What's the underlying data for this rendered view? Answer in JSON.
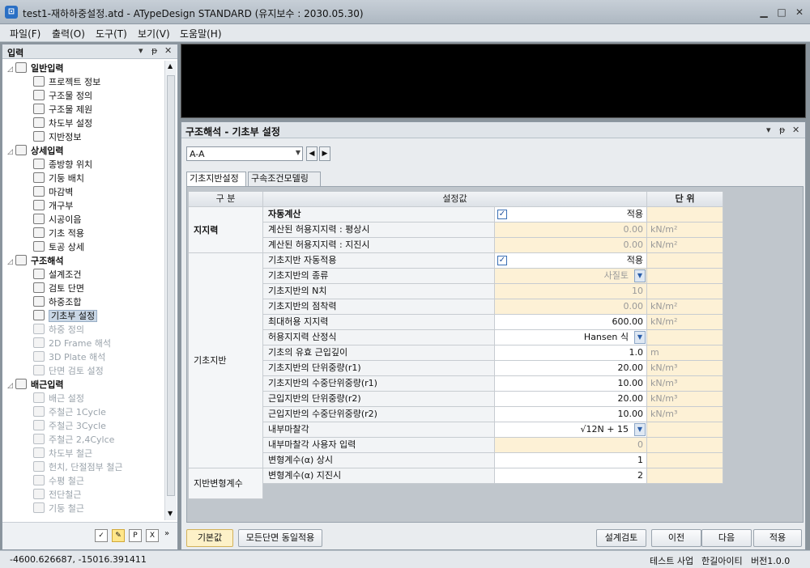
{
  "window": {
    "title": "test1-재하하중설정.atd - ATypeDesign STANDARD  (유지보수 : 2030.05.30)"
  },
  "menu": [
    "파일(F)",
    "출력(O)",
    "도구(T)",
    "보기(V)",
    "도움말(H)"
  ],
  "left_panel": {
    "title": "입력",
    "tree": [
      {
        "label": "일반입력",
        "group": true,
        "icon": "document-icon"
      },
      {
        "label": "프로젝트 정보",
        "icon": "project-info-icon"
      },
      {
        "label": "구조물 정의",
        "icon": "structure-define-icon"
      },
      {
        "label": "구조물 제원",
        "icon": "structure-spec-icon"
      },
      {
        "label": "차도부 설정",
        "icon": "road-setting-icon"
      },
      {
        "label": "지반정보",
        "icon": "ground-info-icon"
      },
      {
        "label": "상세입력",
        "group": true,
        "icon": "detail-input-icon"
      },
      {
        "label": "종방향 위치",
        "icon": "longitudinal-position-icon"
      },
      {
        "label": "기둥 배치",
        "icon": "column-layout-icon"
      },
      {
        "label": "마감벽",
        "icon": "finish-wall-icon"
      },
      {
        "label": "개구부",
        "icon": "opening-icon"
      },
      {
        "label": "시공이음",
        "icon": "construction-joint-icon"
      },
      {
        "label": "기초 적용",
        "icon": "foundation-apply-icon"
      },
      {
        "label": "토공 상세",
        "icon": "earthwork-icon"
      },
      {
        "label": "구조해석",
        "group": true,
        "icon": "structural-analysis-icon"
      },
      {
        "label": "설계조건",
        "icon": "design-condition-icon"
      },
      {
        "label": "검토 단면",
        "icon": "review-section-icon"
      },
      {
        "label": "하중조합",
        "icon": "load-combination-icon"
      },
      {
        "label": "기초부 설정",
        "icon": "foundation-setting-icon",
        "selected": true
      },
      {
        "label": "하중 정의",
        "icon": "load-define-icon",
        "disabled": true
      },
      {
        "label": "2D Frame 해석",
        "icon": "frame-2d-icon",
        "disabled": true
      },
      {
        "label": "3D Plate 해석",
        "icon": "plate-3d-icon",
        "disabled": true
      },
      {
        "label": "단면 검토 설정",
        "icon": "section-check-icon",
        "disabled": true
      },
      {
        "label": "배근입력",
        "group": true,
        "icon": "rebar-input-icon"
      },
      {
        "label": "배근 설정",
        "icon": "rebar-setting-icon",
        "disabled": true
      },
      {
        "label": "주철근 1Cycle",
        "icon": "main-rebar-1-icon",
        "disabled": true
      },
      {
        "label": "주철근 3Cycle",
        "icon": "main-rebar-3-icon",
        "disabled": true
      },
      {
        "label": "주철근 2,4Cylce",
        "icon": "main-rebar-24-icon",
        "disabled": true
      },
      {
        "label": "차도부 철근",
        "icon": "road-rebar-icon",
        "disabled": true
      },
      {
        "label": "헌치, 단절점부 철근",
        "icon": "haunch-rebar-icon",
        "disabled": true
      },
      {
        "label": "수평 철근",
        "icon": "horizontal-rebar-icon",
        "disabled": true
      },
      {
        "label": "전단철근",
        "icon": "shear-rebar-icon",
        "disabled": true
      },
      {
        "label": "기둥 철근",
        "icon": "column-rebar-icon",
        "disabled": true
      }
    ]
  },
  "panel": {
    "title": "구조해석 - 기초부 설정",
    "section_select": "A-A",
    "tabs": [
      "기초지반설정",
      "구속조건모델링"
    ],
    "headers": [
      "구 분",
      "설정값",
      "단 위"
    ],
    "groups": [
      {
        "name": "지지력",
        "rows": 3
      },
      {
        "name": "기초지반",
        "rows": 14
      },
      {
        "name": "지반변형계수",
        "rows": 2
      }
    ],
    "rows": [
      {
        "label": "자동계산",
        "value": "적용",
        "unit": "",
        "check": true,
        "bold": true,
        "editable": true
      },
      {
        "label": "계산된 허용지지력 : 평상시",
        "value": "0.00",
        "unit": "kN/m²",
        "editable": false
      },
      {
        "label": "계산된 허용지지력 : 지진시",
        "value": "0.00",
        "unit": "kN/m²",
        "editable": false
      },
      {
        "label": "기초지반 자동적용",
        "value": "적용",
        "unit": "",
        "check": true,
        "editable": true
      },
      {
        "label": "기초지반의 종류",
        "value": "사질토",
        "unit": "",
        "dropdown": true,
        "editable": false
      },
      {
        "label": "기초지반의 N치",
        "value": "10",
        "unit": "",
        "editable": false
      },
      {
        "label": "기초지반의 점착력",
        "value": "0.00",
        "unit": "kN/m²",
        "editable": false
      },
      {
        "label": "최대허용 지지력",
        "value": "600.00",
        "unit": "kN/m²",
        "editable": true
      },
      {
        "label": "허용지지력 산정식",
        "value": "Hansen  식",
        "unit": "",
        "dropdown": true,
        "editable": true
      },
      {
        "label": "기초의 유효 근입깊이",
        "value": "1.0",
        "unit": "m",
        "editable": true
      },
      {
        "label": "기초지반의 단위중량(r1)",
        "value": "20.00",
        "unit": "kN/m³",
        "editable": true
      },
      {
        "label": "기초지반의 수중단위중량(r1)",
        "value": "10.00",
        "unit": "kN/m³",
        "editable": true
      },
      {
        "label": "근입지반의 단위중량(r2)",
        "value": "20.00",
        "unit": "kN/m³",
        "editable": true
      },
      {
        "label": "근입지반의 수중단위중량(r2)",
        "value": "10.00",
        "unit": "kN/m³",
        "editable": true
      },
      {
        "label": "내부마찰각",
        "value": "√12N + 15",
        "unit": "",
        "dropdown": true,
        "editable": true
      },
      {
        "label": "내부마찰각 사용자 입력",
        "value": "0",
        "unit": "",
        "editable": false
      },
      {
        "label": "변형계수(α) 상시",
        "value": "1",
        "unit": "",
        "editable": true
      },
      {
        "label": "변형계수(α) 지진시",
        "value": "2",
        "unit": "",
        "editable": true
      }
    ],
    "buttons_left": [
      "기본값",
      "모든단면 동일적용"
    ],
    "buttons_right": [
      "설계검토",
      "이전",
      "다음",
      "적용"
    ]
  },
  "status": {
    "coords": "-4600.626687,  -15016.391411",
    "project": "테스트 사업",
    "company": "한길아이티",
    "version": "버전1.0.0"
  },
  "colors": {
    "editable_bg": "#ffffff",
    "readonly_bg": "#fdf1d6",
    "selection": "#c9d7e6"
  }
}
